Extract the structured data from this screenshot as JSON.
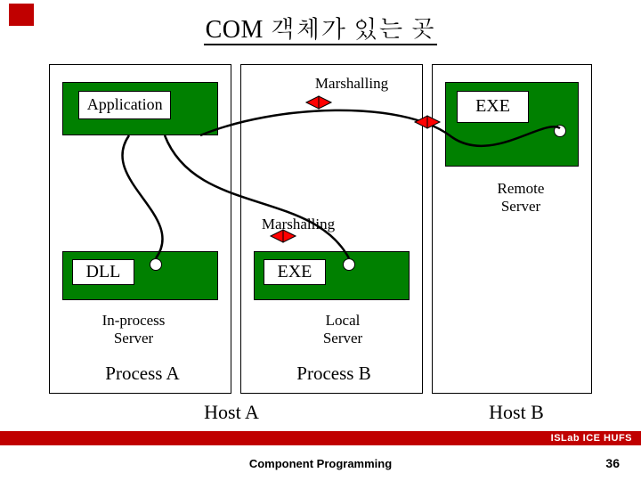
{
  "title": "COM 객체가 있는 곳",
  "app_label": "Application",
  "dll_label": "DLL",
  "exe_label": "EXE",
  "remote_exe_label": "EXE",
  "marshalling": "Marshalling",
  "inprocess": "In-process\nServer",
  "local_server": "Local\nServer",
  "remote_server": "Remote\nServer",
  "process_a": "Process A",
  "process_b": "Process B",
  "host_a": "Host A",
  "host_b": "Host B",
  "footer_lab": "ISLab ICE HUFS",
  "footer_caption": "Component Programming",
  "page_num": "36"
}
